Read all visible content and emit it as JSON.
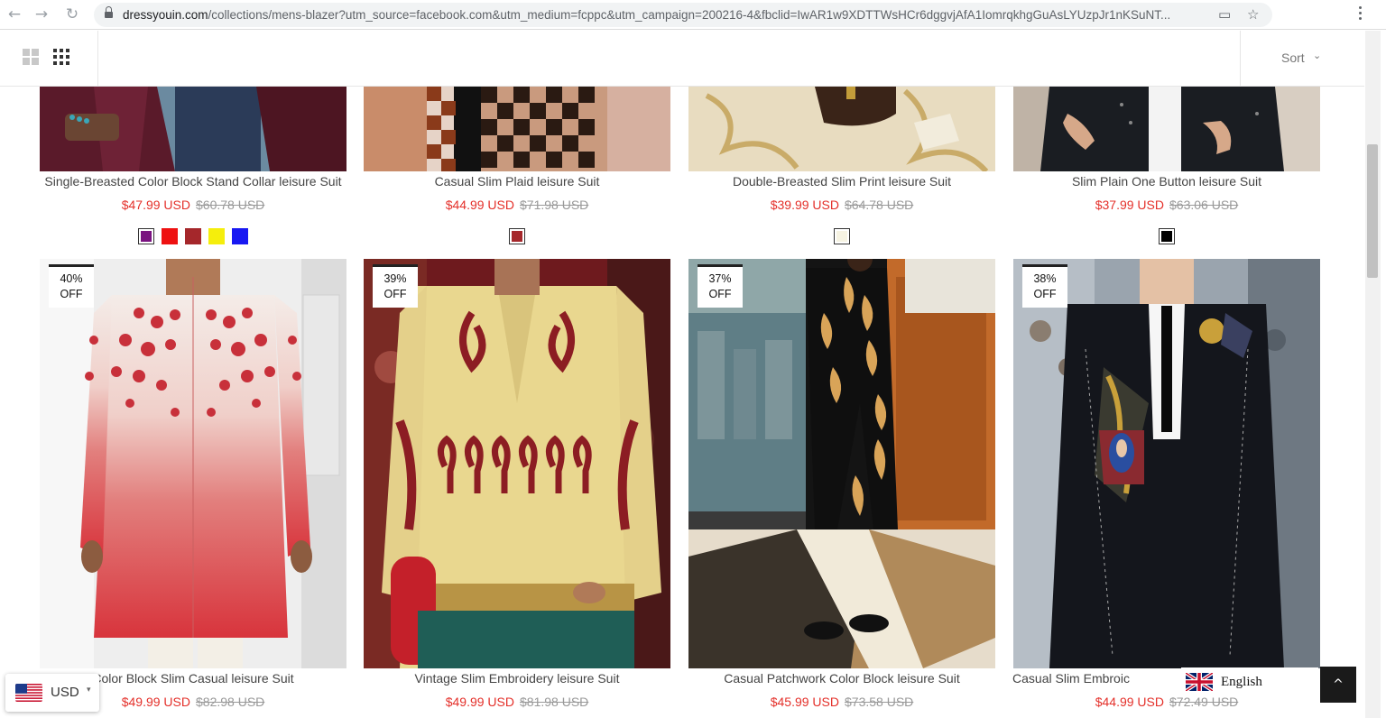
{
  "browser": {
    "back_icon": "arrow-left-icon",
    "forward_icon": "arrow-right-icon",
    "reload_icon": "reload-icon",
    "url_host": "dressyouin.com",
    "url_rest": "/collections/mens-blazer?utm_source=facebook.com&utm_medium=fcppc&utm_campaign=200216-4&fbclid=IwAR1w9XDTTWsHCr6dggvjAfA1IomrqkhgGuAsLYUzpJr1nKSuNT..."
  },
  "toolbar": {
    "sort_label": "Sort",
    "sort_chevron": "⌄"
  },
  "products": [
    {
      "name": "Single-Breasted Color Block Stand Collar leisure Suit",
      "price": "$47.99 USD",
      "compare": "$60.78 USD",
      "swatches": [
        "#7a1280",
        "#ee1111",
        "#a5272b",
        "#f5ee0c",
        "#1818f2"
      ]
    },
    {
      "name": "Casual Slim Plaid leisure Suit",
      "price": "$44.99 USD",
      "compare": "$71.98 USD",
      "swatches": [
        "#a5272b"
      ]
    },
    {
      "name": "Double-Breasted Slim Print leisure Suit",
      "price": "$39.99 USD",
      "compare": "$64.78 USD",
      "swatches": [
        "#f6f3e2"
      ]
    },
    {
      "name": "Slim Plain One Button leisure Suit",
      "price": "$37.99 USD",
      "compare": "$63.06 USD",
      "swatches": [
        "#000000"
      ]
    },
    {
      "name": "Color Block Slim Casual leisure Suit",
      "price": "$49.99 USD",
      "compare": "$82.98 USD",
      "badge_pct": "40%",
      "badge_off": "OFF"
    },
    {
      "name": "Vintage Slim Embroidery leisure Suit",
      "price": "$49.99 USD",
      "compare": "$81.98 USD",
      "badge_pct": "39%",
      "badge_off": "OFF"
    },
    {
      "name": "Casual Patchwork Color Block leisure Suit",
      "price": "$45.99 USD",
      "compare": "$73.58 USD",
      "badge_pct": "37%",
      "badge_off": "OFF"
    },
    {
      "name": "Casual Slim Embroic",
      "price": "$44.99 USD",
      "compare": "$72.49 USD",
      "badge_pct": "38%",
      "badge_off": "OFF"
    }
  ],
  "currency": {
    "label": "USD",
    "caret": "▾",
    "flag_icon": "us-flag-icon"
  },
  "language": {
    "label": "English",
    "flag_icon": "uk-flag-icon"
  },
  "back_to_top": {
    "icon": "chevron-up-icon",
    "glyph": "^"
  }
}
